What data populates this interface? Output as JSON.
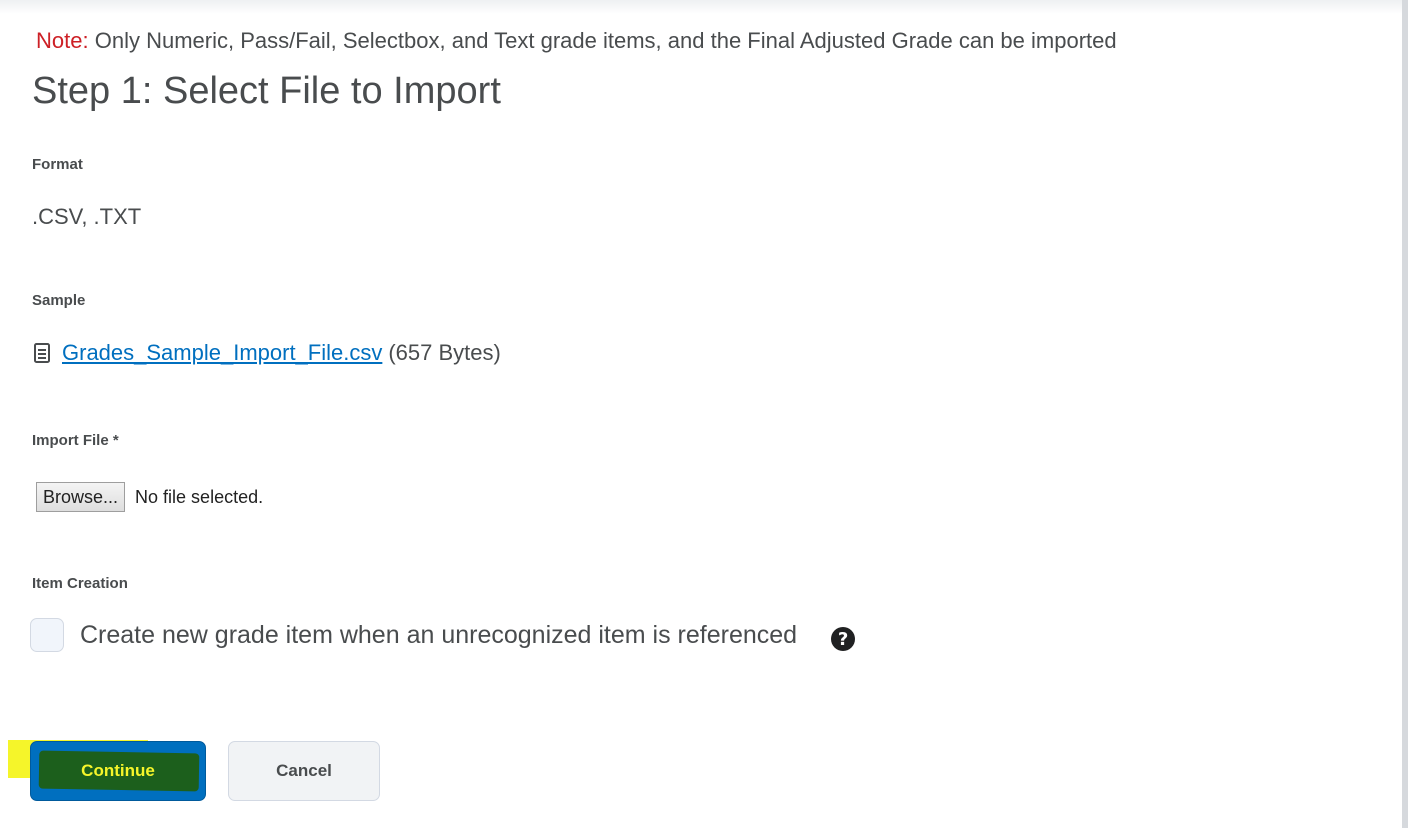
{
  "note": {
    "prefix": "Note:",
    "text": "Only Numeric, Pass/Fail, Selectbox, and Text grade items, and the Final Adjusted Grade can be imported"
  },
  "step_title": "Step 1: Select File to Import",
  "format": {
    "label": "Format",
    "value": ".CSV, .TXT"
  },
  "sample": {
    "label": "Sample",
    "icon": "document-icon",
    "file_name": "Grades_Sample_Import_File.csv",
    "file_size": "(657 Bytes)"
  },
  "import_file": {
    "label": "Import File *",
    "browse_label": "Browse...",
    "status": "No file selected."
  },
  "item_creation": {
    "label": "Item Creation",
    "checkbox_label": "Create new grade item when an unrecognized item is referenced",
    "checked": false,
    "help_icon": "help-icon",
    "help_glyph": "?"
  },
  "actions": {
    "continue_label": "Continue",
    "cancel_label": "Cancel"
  },
  "colors": {
    "note_prefix": "#cd2026",
    "link": "#006fbf",
    "primary_button": "#006fbf",
    "highlight": "#f5f52a"
  }
}
